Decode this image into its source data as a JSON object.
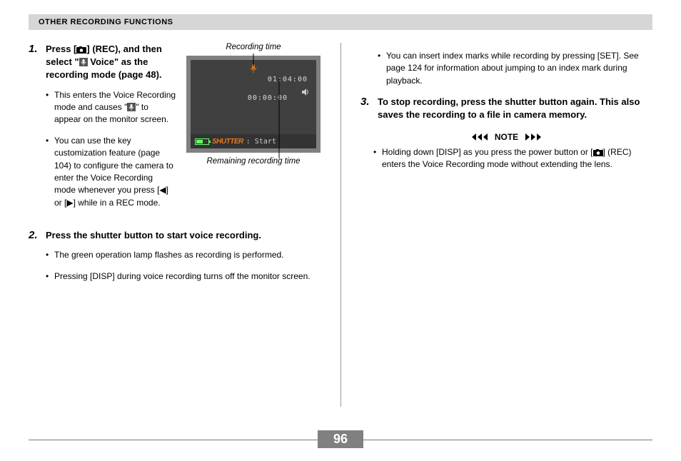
{
  "header": "OTHER RECORDING FUNCTIONS",
  "page_number": "96",
  "figure": {
    "label_top": "Recording time",
    "label_bottom": "Remaining recording time",
    "time_top": "01:04:00",
    "time_bottom": "00:00:00",
    "shutter": "SHUTTER",
    "start": ": Start"
  },
  "left": {
    "step1_num": "1.",
    "step1_title_a": "Press [",
    "step1_title_b": "] (REC), and then select \"",
    "step1_title_c": " Voice\" as the recording mode (page 48).",
    "step1_b1_a": "This enters the Voice Recording mode and causes \"",
    "step1_b1_b": "\" to appear on the monitor screen.",
    "step1_b2": "You can use the key customization feature (page 104) to configure the camera to enter the Voice Recording mode whenever you press [◀] or [▶] while in a REC mode.",
    "step2_num": "2.",
    "step2_title": "Press the shutter button to start voice recording.",
    "step2_b1": "The green operation lamp flashes as recording is performed.",
    "step2_b2": "Pressing [DISP] during voice recording turns off the monitor screen."
  },
  "right": {
    "top_bullet": "You can insert index marks while recording by pressing [SET]. See page 124 for information about jumping to an index mark during playback.",
    "step3_num": "3.",
    "step3_title": "To stop recording, press the shutter button again. This also saves the recording to a file in camera memory.",
    "note_label": "NOTE",
    "note_b1_a": "Holding down [DISP] as you press the power button or [",
    "note_b1_b": "] (REC) enters the Voice Recording mode without extending the lens."
  }
}
